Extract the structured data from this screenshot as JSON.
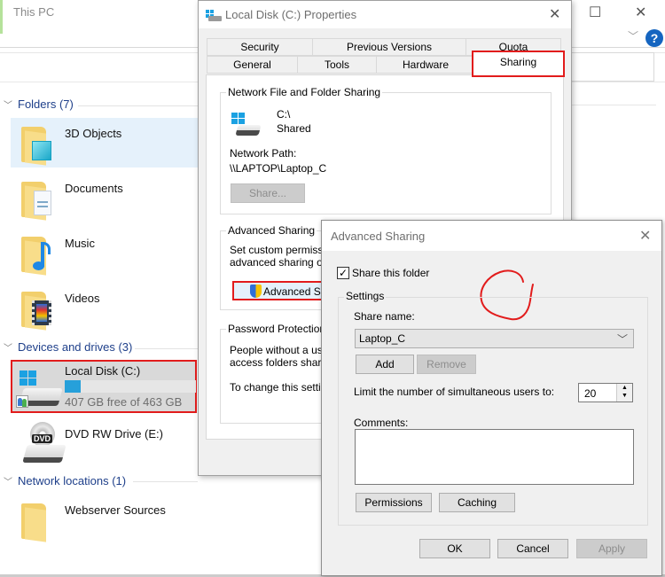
{
  "explorer": {
    "title": "This PC",
    "window_controls": {
      "maximize": "☐",
      "close": "✕"
    },
    "help_label": "?",
    "groups": {
      "folders": {
        "label": "Folders (7)"
      },
      "devices": {
        "label": "Devices and drives (3)"
      },
      "network": {
        "label": "Network locations (1)"
      }
    },
    "folders": [
      {
        "label": "3D Objects",
        "icon": "3d-objects-folder-icon"
      },
      {
        "label": "Documents",
        "icon": "documents-folder-icon"
      },
      {
        "label": "Music",
        "icon": "music-folder-icon"
      },
      {
        "label": "Videos",
        "icon": "videos-folder-icon"
      }
    ],
    "drives": [
      {
        "label": "Local Disk (C:)",
        "free_text": "407 GB free of 463 GB",
        "used_fraction": 0.121
      },
      {
        "label": "DVD RW Drive (E:)",
        "badge": "DVD"
      }
    ],
    "network_locations": [
      {
        "label": "Webserver Sources"
      }
    ]
  },
  "properties": {
    "title": "Local Disk (C:) Properties",
    "close": "✕",
    "tabs_row1": [
      "Security",
      "Previous Versions",
      "Quota"
    ],
    "tabs_row2": [
      "General",
      "Tools",
      "Hardware",
      "Sharing"
    ],
    "active_tab": "Sharing",
    "network_sharing": {
      "legend": "Network File and Folder Sharing",
      "path": "C:\\",
      "status": "Shared",
      "network_path_label": "Network Path:",
      "network_path": "\\\\LAPTOP\\Laptop_C",
      "share_button": "Share..."
    },
    "advanced_sharing": {
      "legend": "Advanced Sharing",
      "desc_line1": "Set custom permissi",
      "desc_line2": "advanced sharing o",
      "button": "Advanced S"
    },
    "password_protection": {
      "legend": "Password Protection",
      "desc_line1": "People without a use",
      "desc_line2": "access folders share",
      "desc_line3": "To change this settin"
    }
  },
  "advanced_dialog": {
    "title": "Advanced Sharing",
    "close": "✕",
    "share_checkbox_label": "Share this folder",
    "share_checked": true,
    "settings_legend": "Settings",
    "share_name_label": "Share name:",
    "share_name_value": "Laptop_C",
    "add_button": "Add",
    "remove_button": "Remove",
    "limit_label": "Limit the number of simultaneous users to:",
    "limit_value": "20",
    "comments_label": "Comments:",
    "comments_value": "",
    "permissions_button": "Permissions",
    "caching_button": "Caching",
    "ok_button": "OK",
    "cancel_button": "Cancel",
    "apply_button": "Apply"
  },
  "annotations": {
    "highlight_color": "#e21c1c"
  }
}
